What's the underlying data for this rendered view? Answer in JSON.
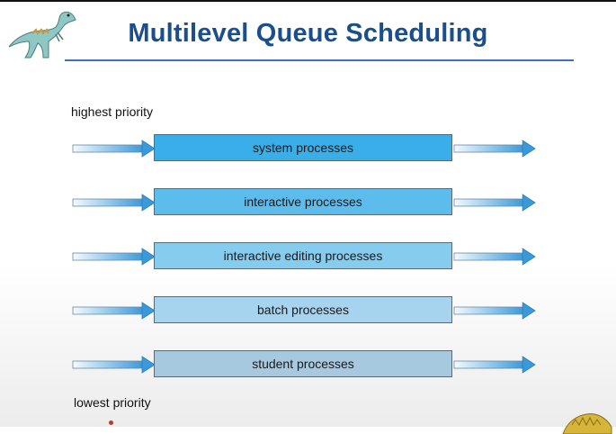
{
  "slide": {
    "title": "Multilevel Queue Scheduling",
    "highest_priority_label": "highest priority",
    "lowest_priority_label": "lowest priority"
  },
  "queues": [
    {
      "label": "system processes",
      "color": "#3aaee8"
    },
    {
      "label": "interactive processes",
      "color": "#5cbcec"
    },
    {
      "label": "interactive editing processes",
      "color": "#85ccef"
    },
    {
      "label": "batch processes",
      "color": "#a6d4ef"
    },
    {
      "label": "student processes",
      "color": "#a7c9e0"
    }
  ],
  "colors": {
    "title": "#1a4f8c",
    "rule": "#3d72b4",
    "arrow": "#3a9ad9"
  },
  "icons": [
    "dinosaur-logo-icon",
    "dinosaur-corner-icon"
  ]
}
